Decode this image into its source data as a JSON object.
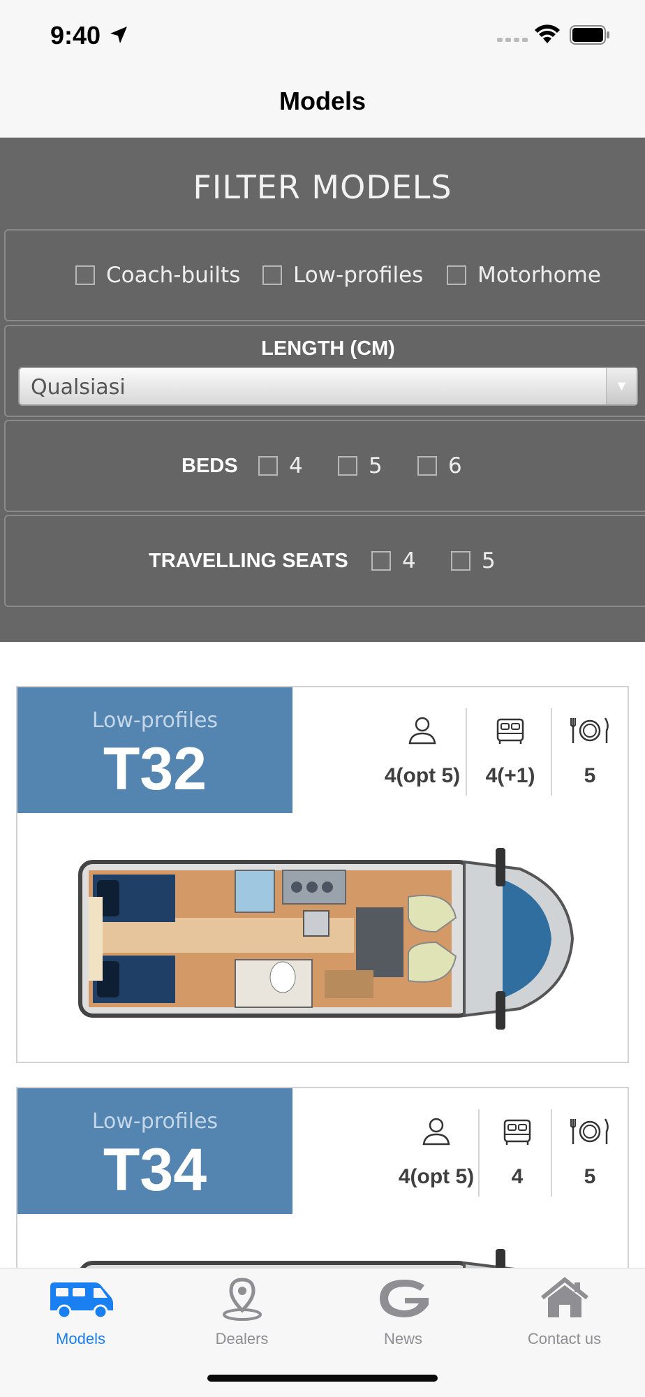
{
  "status_bar": {
    "time": "9:40"
  },
  "nav": {
    "title": "Models"
  },
  "filter": {
    "heading": "FILTER MODELS",
    "types": [
      "Coach-builts",
      "Low-profiles",
      "Motorhome"
    ],
    "length_label": "LENGTH (CM)",
    "length_value": "Qualsiasi",
    "beds_label": "BEDS",
    "beds": [
      "4",
      "5",
      "6"
    ],
    "seats_label": "TRAVELLING SEATS",
    "seats": [
      "4",
      "5"
    ]
  },
  "models": [
    {
      "category": "Low-profiles",
      "name": "T32",
      "seats": "4(opt 5)",
      "beds": "4(+1)",
      "dining": "5"
    },
    {
      "category": "Low-profiles",
      "name": "T34",
      "seats": "4(opt 5)",
      "beds": "4",
      "dining": "5"
    }
  ],
  "tabs": [
    {
      "label": "Models",
      "icon": "camper-van-icon",
      "active": true
    },
    {
      "label": "Dealers",
      "icon": "map-pin-icon",
      "active": false
    },
    {
      "label": "News",
      "icon": "g-logo-icon",
      "active": false
    },
    {
      "label": "Contact us",
      "icon": "house-icon",
      "active": false
    }
  ],
  "colors": {
    "accent": "#1a7ff0",
    "badge": "#5484b0",
    "filter_bg": "#676767"
  }
}
